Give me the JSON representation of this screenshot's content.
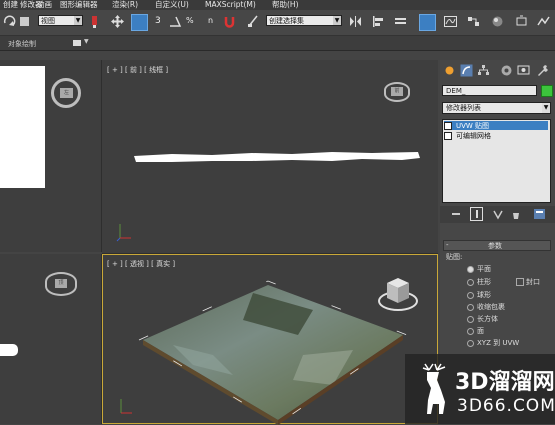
{
  "menu": [
    "创建",
    "修改器",
    "动画",
    "图形编辑器",
    "渲染(R)",
    "自定义(U)",
    "MAXScript(M)",
    "帮助(H)"
  ],
  "toolbar": {
    "view_dropdown": "视图",
    "num_3": "3",
    "percent": "%",
    "num_n": "n",
    "selection_set": "创建选择集"
  },
  "ribbon": {
    "label": "对象绘制"
  },
  "viewports": {
    "top": {
      "label": "[ + ] [ 前 ] [ 线框 ]",
      "cube_text": "前"
    },
    "persp": {
      "label": "[ + ] [ 透视 ] [ 真实 ]"
    },
    "left_top_cube": "左",
    "left_bottom_cube": "顶"
  },
  "panel": {
    "object_name": "DEM_",
    "color_swatch": "#3cc43c",
    "modifier_list": "修改器列表",
    "stack": [
      "UVW 贴图",
      "可编辑网格"
    ],
    "rollout_title": "参数",
    "mapping_label": "贴图:",
    "options": [
      "平面",
      "柱形",
      "封口",
      "球形",
      "收缩包裹",
      "长方体",
      "面",
      "XYZ 到 UVW"
    ]
  },
  "watermark": {
    "brand": "3D溜溜网",
    "url": "3D66.COM"
  }
}
